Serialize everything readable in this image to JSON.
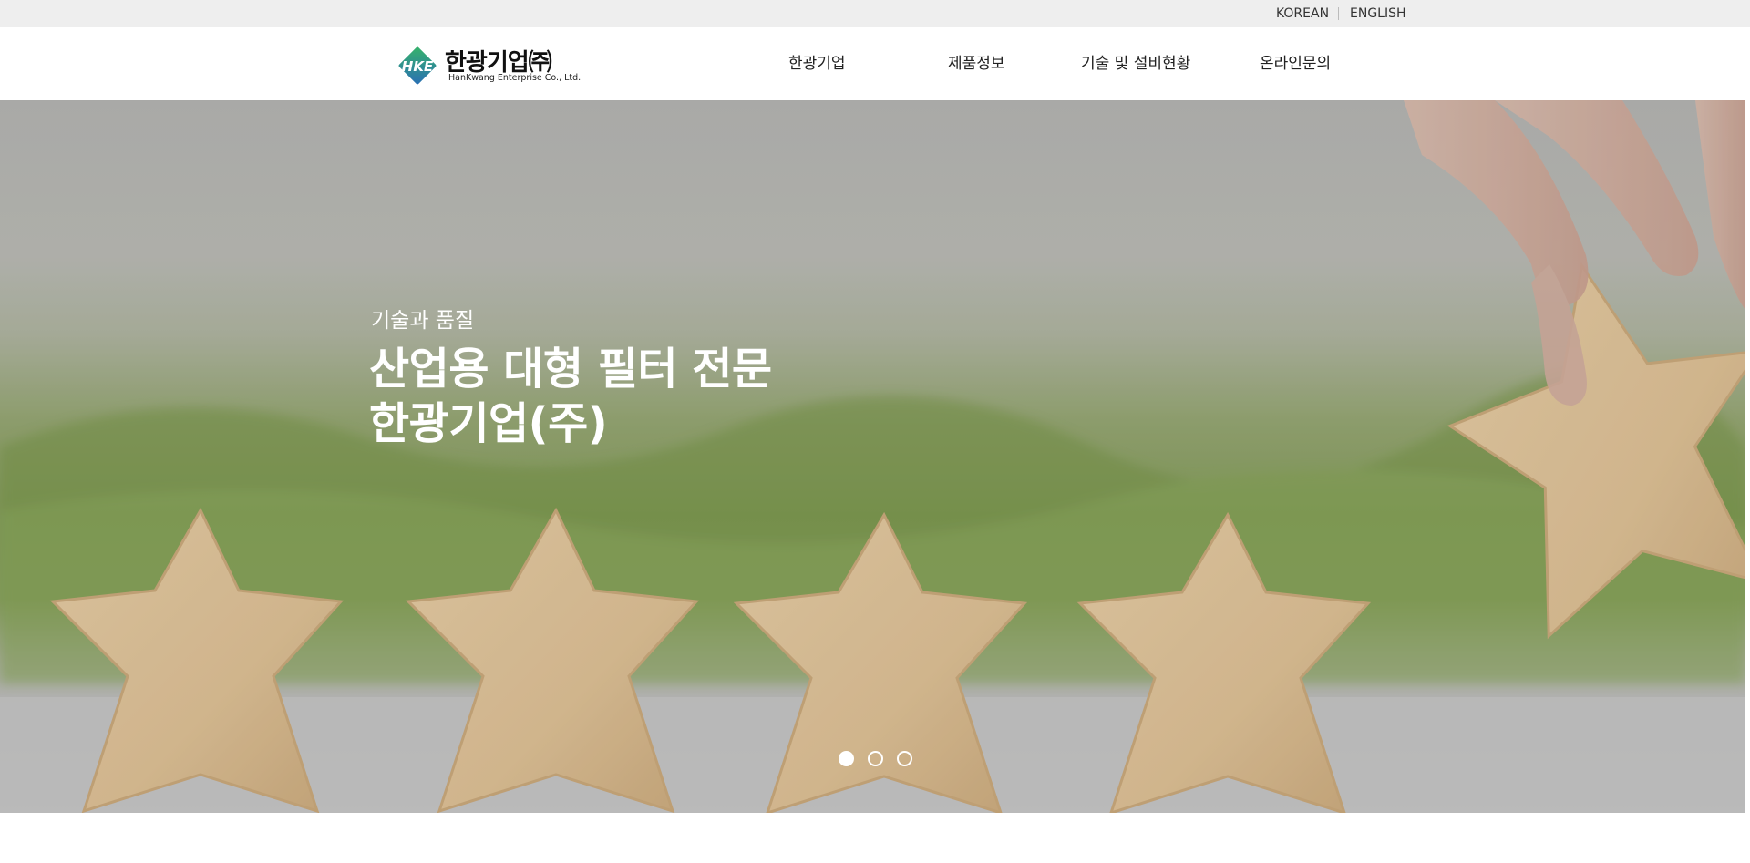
{
  "topbar": {
    "languages": [
      "KOREAN",
      "ENGLISH"
    ]
  },
  "logo": {
    "mark_text": "HKE",
    "korean_name": "한광기업㈜",
    "english_name": "HanKwang Enterprise Co., Ltd."
  },
  "nav": {
    "items": [
      "한광기업",
      "제품정보",
      "기술 및 설비현황",
      "온라인문의"
    ]
  },
  "hero": {
    "subtitle": "기술과 품질",
    "title_line1": "산업용 대형 필터 전문",
    "title_line2": "한광기업(주)",
    "slides_total": 3,
    "active_slide": 1
  },
  "colors": {
    "topbar_bg": "#eeeeee",
    "logo_green": "#2e9e55",
    "logo_blue": "#2a6fb5",
    "star_wood": "#dcc098"
  }
}
